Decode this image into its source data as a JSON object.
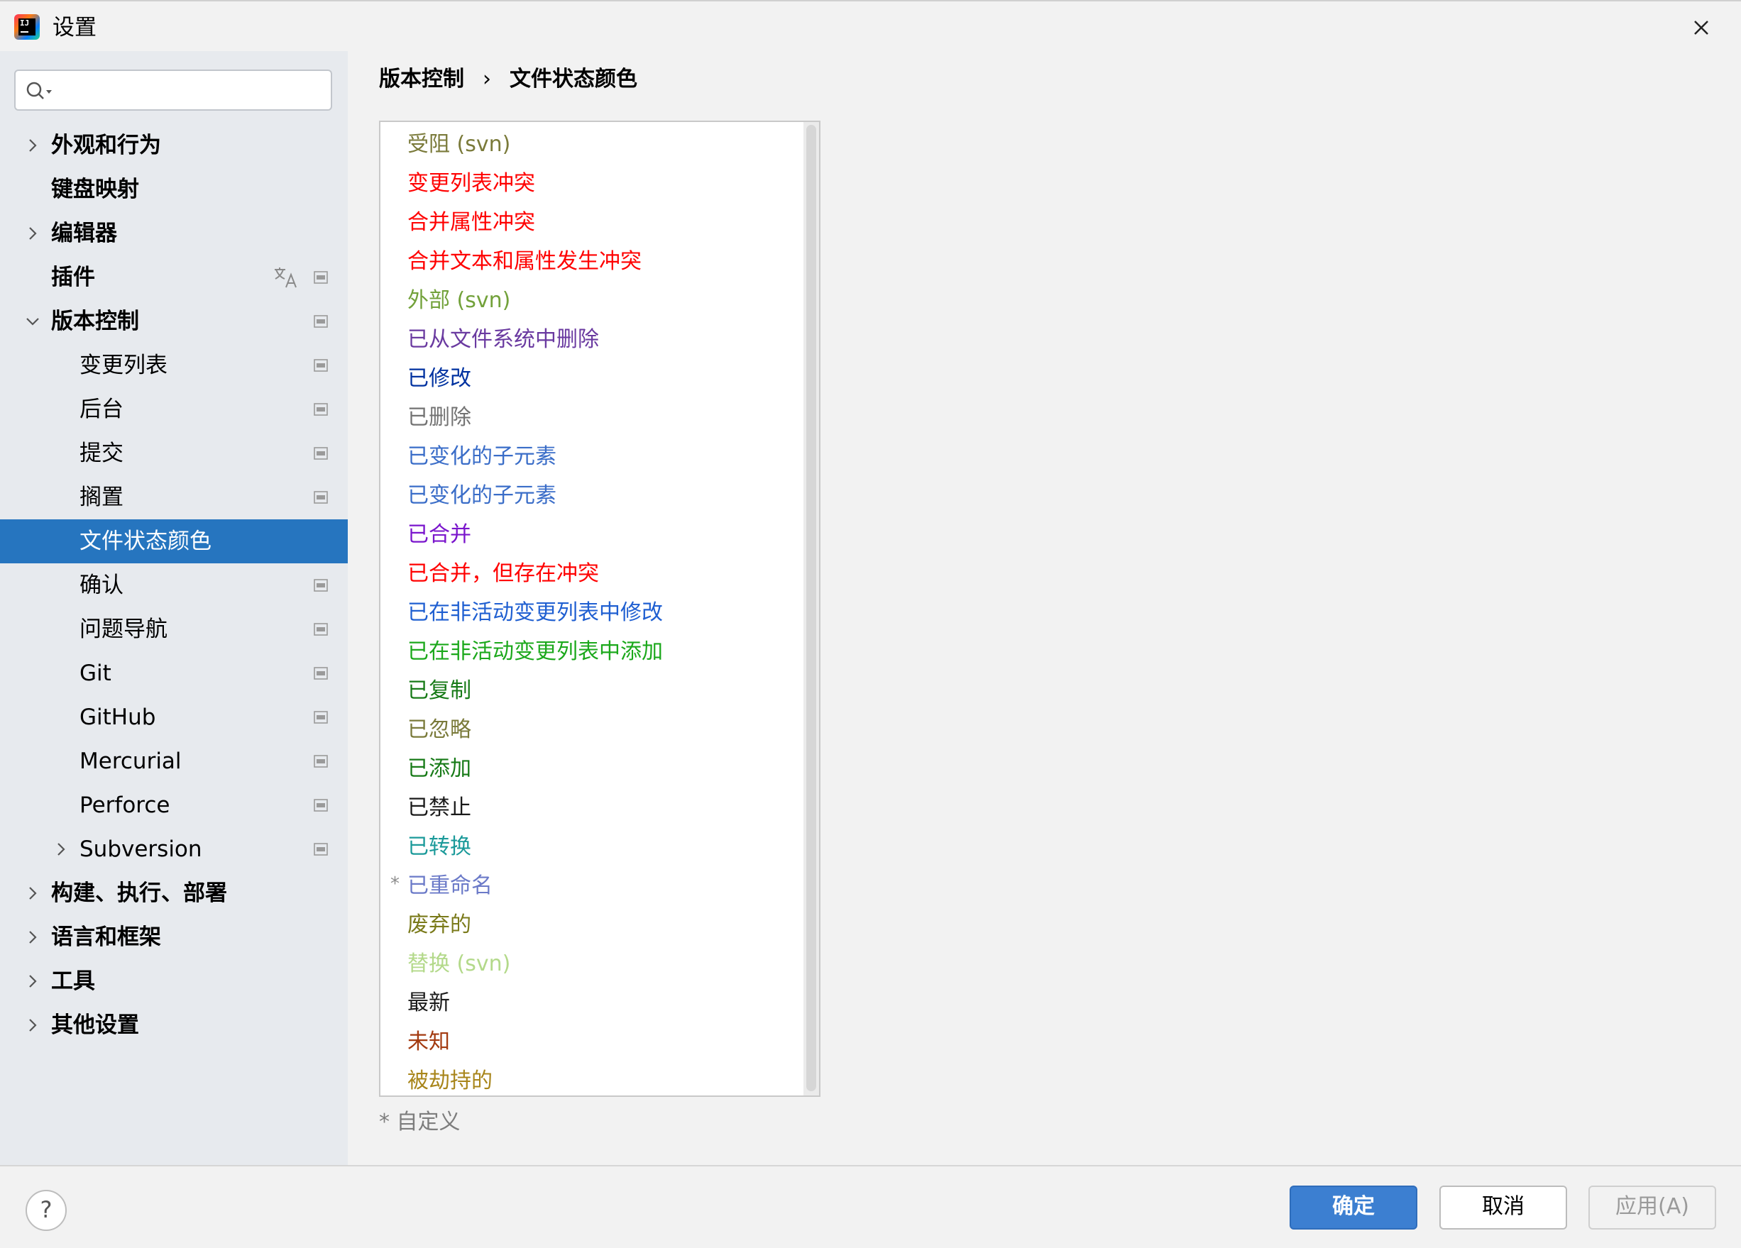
{
  "window": {
    "title": "设置",
    "close_icon": "close-icon"
  },
  "search": {
    "value": "",
    "placeholder": ""
  },
  "sidebar": {
    "items": [
      {
        "label": "外观和行为"
      },
      {
        "label": "键盘映射"
      },
      {
        "label": "编辑器"
      },
      {
        "label": "插件"
      },
      {
        "label": "版本控制"
      },
      {
        "label": "变更列表"
      },
      {
        "label": "后台"
      },
      {
        "label": "提交"
      },
      {
        "label": "搁置"
      },
      {
        "label": "文件状态颜色"
      },
      {
        "label": "确认"
      },
      {
        "label": "问题导航"
      },
      {
        "label": "Git"
      },
      {
        "label": "GitHub"
      },
      {
        "label": "Mercurial"
      },
      {
        "label": "Perforce"
      },
      {
        "label": "Subversion"
      },
      {
        "label": "构建、执行、部署"
      },
      {
        "label": "语言和框架"
      },
      {
        "label": "工具"
      },
      {
        "label": "其他设置"
      }
    ]
  },
  "breadcrumb": {
    "parent": "版本控制",
    "separator": "›",
    "current": "文件状态颜色"
  },
  "status_list": {
    "items": [
      {
        "label": "受阻 (svn)",
        "color": "#7a7a3a"
      },
      {
        "label": "变更列表冲突",
        "color": "#ff0000"
      },
      {
        "label": "合并属性冲突",
        "color": "#ff0000"
      },
      {
        "label": "合并文本和属性发生冲突",
        "color": "#ff0000"
      },
      {
        "label": "外部 (svn)",
        "color": "#72a13a"
      },
      {
        "label": "已从文件系统中删除",
        "color": "#6a3aa0"
      },
      {
        "label": "已修改",
        "color": "#0032a0"
      },
      {
        "label": "已删除",
        "color": "#737373"
      },
      {
        "label": "已变化的子元素",
        "color": "#3a6dc8"
      },
      {
        "label": "已变化的子元素",
        "color": "#3a6dc8"
      },
      {
        "label": "已合并",
        "color": "#7a15cc"
      },
      {
        "label": "已合并，但存在冲突",
        "color": "#ff0000"
      },
      {
        "label": "已在非活动变更列表中修改",
        "color": "#1f5fd1"
      },
      {
        "label": "已在非活动变更列表中添加",
        "color": "#1ba81b"
      },
      {
        "label": "已复制",
        "color": "#177a17"
      },
      {
        "label": "已忽略",
        "color": "#7a7a3a"
      },
      {
        "label": "已添加",
        "color": "#177a17"
      },
      {
        "label": "已禁止",
        "color": "#1a1a1a"
      },
      {
        "label": "已转换",
        "color": "#1b9a9a"
      },
      {
        "label": "已重命名",
        "color": "#6b7ac8",
        "custom": true
      },
      {
        "label": "废弃的",
        "color": "#7a7a1a"
      },
      {
        "label": "替换 (svn)",
        "color": "#b3d98a"
      },
      {
        "label": "最新",
        "color": "#1a1a1a"
      },
      {
        "label": "未知",
        "color": "#a33a10"
      },
      {
        "label": "被劫持的",
        "color": "#a8851a"
      }
    ],
    "custom_marker": "*"
  },
  "footnote": "* 自定义",
  "footer": {
    "help": "?",
    "ok": "确定",
    "cancel": "取消",
    "apply": "应用(A)"
  },
  "colors": {
    "accent": "#2675bf",
    "primary_button": "#3c7fd1",
    "sidebar_bg": "#e7eaee"
  }
}
